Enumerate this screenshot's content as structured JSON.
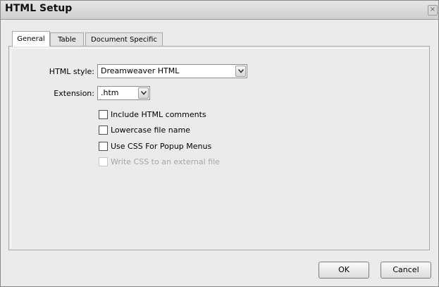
{
  "window": {
    "title": "HTML Setup",
    "close_glyph": "×"
  },
  "tabs": [
    {
      "label": "General",
      "active": true
    },
    {
      "label": "Table",
      "active": false
    },
    {
      "label": "Document Specific",
      "active": false
    }
  ],
  "general": {
    "html_style": {
      "label": "HTML style:",
      "value": "Dreamweaver HTML"
    },
    "extension": {
      "label": "Extension:",
      "value": ".htm"
    },
    "options": [
      {
        "label": "Include HTML comments",
        "checked": false,
        "enabled": true
      },
      {
        "label": "Lowercase file name",
        "checked": false,
        "enabled": true
      },
      {
        "label": "Use CSS For Popup Menus",
        "checked": false,
        "enabled": true
      },
      {
        "label": "Write CSS to an external file",
        "checked": false,
        "enabled": false
      }
    ]
  },
  "buttons": {
    "ok": "OK",
    "cancel": "Cancel"
  },
  "icons": {
    "close": "close-icon",
    "dropdown": "chevron-down-icon"
  }
}
